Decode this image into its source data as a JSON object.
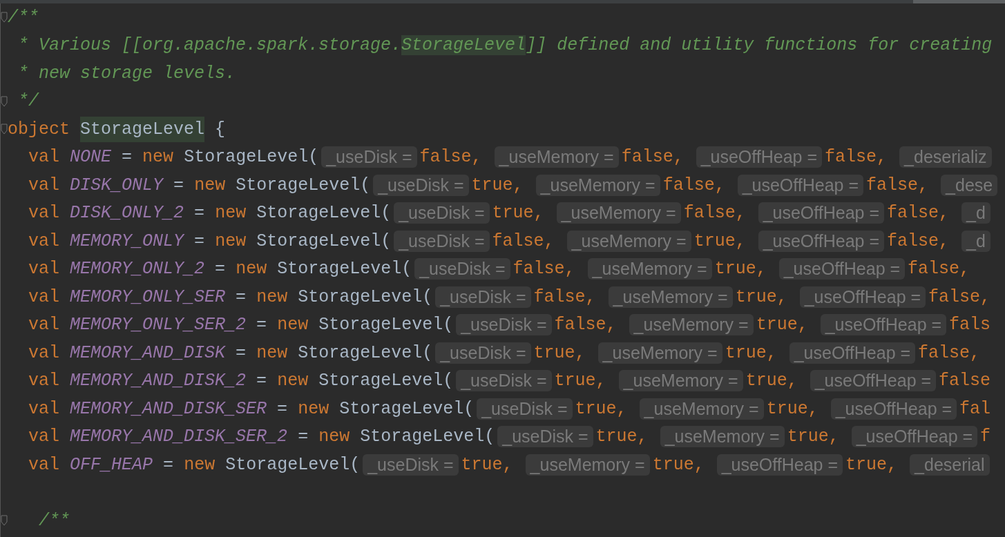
{
  "lines": [
    {
      "kind": "comment",
      "fold": true,
      "segments": [
        {
          "text": "/**",
          "highlight": false
        }
      ]
    },
    {
      "kind": "comment",
      "fold": false,
      "segments": [
        {
          "text": " * Various [[org.apache.spark.storage.",
          "highlight": false
        },
        {
          "text": "StorageLevel",
          "highlight": true
        },
        {
          "text": "]] defined and utility functions for creating",
          "highlight": false
        }
      ]
    },
    {
      "kind": "comment",
      "fold": false,
      "segments": [
        {
          "text": " * new storage levels.",
          "highlight": false
        }
      ]
    },
    {
      "kind": "comment",
      "fold": true,
      "segments": [
        {
          "text": " */",
          "highlight": false
        }
      ]
    },
    {
      "kind": "object",
      "fold": true,
      "keyword": "object",
      "name": "StorageLevel",
      "highlight": true,
      "brace": "{"
    },
    {
      "kind": "val",
      "fold": false,
      "keyword": "val",
      "name": "NONE",
      "op": "=",
      "new": "new",
      "cls": "StorageLevel(",
      "args": [
        {
          "hint": "_useDisk =",
          "value": "false,"
        },
        {
          "hint": "_useMemory =",
          "value": "false,"
        },
        {
          "hint": "_useOffHeap =",
          "value": "false,"
        },
        {
          "hint": "_deserializ"
        }
      ]
    },
    {
      "kind": "val",
      "fold": false,
      "keyword": "val",
      "name": "DISK_ONLY",
      "op": "=",
      "new": "new",
      "cls": "StorageLevel(",
      "args": [
        {
          "hint": "_useDisk =",
          "value": "true,"
        },
        {
          "hint": "_useMemory =",
          "value": "false,"
        },
        {
          "hint": "_useOffHeap =",
          "value": "false,"
        },
        {
          "hint": "_dese"
        }
      ]
    },
    {
      "kind": "val",
      "fold": false,
      "keyword": "val",
      "name": "DISK_ONLY_2",
      "op": "=",
      "new": "new",
      "cls": "StorageLevel(",
      "args": [
        {
          "hint": "_useDisk =",
          "value": "true,"
        },
        {
          "hint": "_useMemory =",
          "value": "false,"
        },
        {
          "hint": "_useOffHeap =",
          "value": "false,"
        },
        {
          "hint": "_d"
        }
      ]
    },
    {
      "kind": "val",
      "fold": false,
      "keyword": "val",
      "name": "MEMORY_ONLY",
      "op": "=",
      "new": "new",
      "cls": "StorageLevel(",
      "args": [
        {
          "hint": "_useDisk =",
          "value": "false,"
        },
        {
          "hint": "_useMemory =",
          "value": "true,"
        },
        {
          "hint": "_useOffHeap =",
          "value": "false,"
        },
        {
          "hint": "_d"
        }
      ]
    },
    {
      "kind": "val",
      "fold": false,
      "keyword": "val",
      "name": "MEMORY_ONLY_2",
      "op": "=",
      "new": "new",
      "cls": "StorageLevel(",
      "args": [
        {
          "hint": "_useDisk =",
          "value": "false,"
        },
        {
          "hint": "_useMemory =",
          "value": "true,"
        },
        {
          "hint": "_useOffHeap =",
          "value": "false,"
        }
      ]
    },
    {
      "kind": "val",
      "fold": false,
      "keyword": "val",
      "name": "MEMORY_ONLY_SER",
      "op": "=",
      "new": "new",
      "cls": "StorageLevel(",
      "args": [
        {
          "hint": "_useDisk =",
          "value": "false,"
        },
        {
          "hint": "_useMemory =",
          "value": "true,"
        },
        {
          "hint": "_useOffHeap =",
          "value": "false,"
        }
      ]
    },
    {
      "kind": "val",
      "fold": false,
      "keyword": "val",
      "name": "MEMORY_ONLY_SER_2",
      "op": "=",
      "new": "new",
      "cls": "StorageLevel(",
      "args": [
        {
          "hint": "_useDisk =",
          "value": "false,"
        },
        {
          "hint": "_useMemory =",
          "value": "true,"
        },
        {
          "hint": "_useOffHeap =",
          "value": "fals"
        }
      ]
    },
    {
      "kind": "val",
      "fold": false,
      "keyword": "val",
      "name": "MEMORY_AND_DISK",
      "op": "=",
      "new": "new",
      "cls": "StorageLevel(",
      "args": [
        {
          "hint": "_useDisk =",
          "value": "true,"
        },
        {
          "hint": "_useMemory =",
          "value": "true,"
        },
        {
          "hint": "_useOffHeap =",
          "value": "false,"
        }
      ]
    },
    {
      "kind": "val",
      "fold": false,
      "keyword": "val",
      "name": "MEMORY_AND_DISK_2",
      "op": "=",
      "new": "new",
      "cls": "StorageLevel(",
      "args": [
        {
          "hint": "_useDisk =",
          "value": "true,"
        },
        {
          "hint": "_useMemory =",
          "value": "true,"
        },
        {
          "hint": "_useOffHeap =",
          "value": "false"
        }
      ]
    },
    {
      "kind": "val",
      "fold": false,
      "keyword": "val",
      "name": "MEMORY_AND_DISK_SER",
      "op": "=",
      "new": "new",
      "cls": "StorageLevel(",
      "args": [
        {
          "hint": "_useDisk =",
          "value": "true,"
        },
        {
          "hint": "_useMemory =",
          "value": "true,"
        },
        {
          "hint": "_useOffHeap =",
          "value": "fal"
        }
      ]
    },
    {
      "kind": "val",
      "fold": false,
      "keyword": "val",
      "name": "MEMORY_AND_DISK_SER_2",
      "op": "=",
      "new": "new",
      "cls": "StorageLevel(",
      "args": [
        {
          "hint": "_useDisk =",
          "value": "true,"
        },
        {
          "hint": "_useMemory =",
          "value": "true,"
        },
        {
          "hint": "_useOffHeap =",
          "value": "f"
        }
      ]
    },
    {
      "kind": "val",
      "fold": false,
      "keyword": "val",
      "name": "OFF_HEAP",
      "op": "=",
      "new": "new",
      "cls": "StorageLevel(",
      "args": [
        {
          "hint": "_useDisk =",
          "value": "true,"
        },
        {
          "hint": "_useMemory =",
          "value": "true,"
        },
        {
          "hint": "_useOffHeap =",
          "value": "true,"
        },
        {
          "hint": "_deserial"
        }
      ]
    },
    {
      "kind": "blank",
      "fold": false
    },
    {
      "kind": "comment",
      "fold": true,
      "segments": [
        {
          "text": "   /**",
          "highlight": false
        }
      ]
    }
  ]
}
